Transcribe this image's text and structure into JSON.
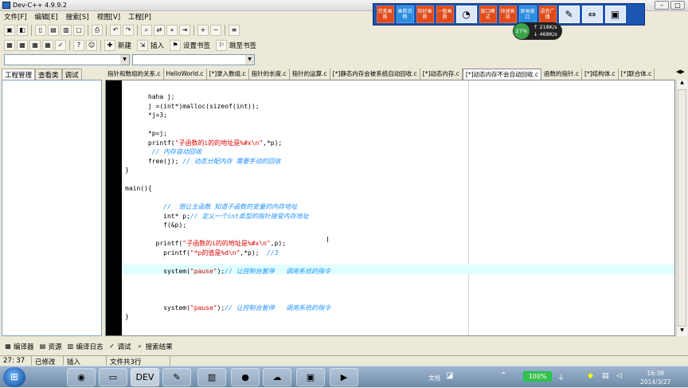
{
  "window": {
    "title": "Dev-C++ 4.9.9.2"
  },
  "menu": [
    "文件[F]",
    "编辑[E]",
    "搜索[S]",
    "视图[V]",
    "工程[P]"
  ],
  "toolbar": {
    "new": "新建",
    "insert": "插入",
    "set_bookmark": "设置书签",
    "goto_bookmark": "跳至书签"
  },
  "float_toolbar": {
    "buttons": [
      "完美画质",
      "画质流畅",
      "较好画质",
      "一般画质",
      "窗口模式",
      "快速高效",
      "原画窗口",
      "语音广播"
    ]
  },
  "speed": {
    "percent": "27%",
    "up": "218K/s",
    "down": "468K/s"
  },
  "left_tabs": [
    "工程管理",
    "查看类",
    "调试"
  ],
  "file_tabs": [
    "指针和数组的关系.c",
    "HelloWorld.c",
    "[*]录入数组.c",
    "指针的长度.c",
    "指针的运算.c",
    "[*]静态内存会被系统自动回收.c",
    "[*]动态内存.c",
    "[*]动态内存不会自动回收.c",
    "函数的指针.c",
    "[*]结构体.c",
    "[*]联合体.c"
  ],
  "code": [
    {
      "indent": "      ",
      "parts": [
        {
          "t": "haha j;",
          "c": ""
        }
      ]
    },
    {
      "indent": "      ",
      "parts": [
        {
          "t": "j =(int*)malloc(sizeof(int));",
          "c": ""
        }
      ]
    },
    {
      "indent": "      ",
      "parts": [
        {
          "t": "*j=3;",
          "c": ""
        }
      ]
    },
    {
      "indent": "",
      "parts": []
    },
    {
      "indent": "      ",
      "parts": [
        {
          "t": "*p=j;",
          "c": ""
        }
      ]
    },
    {
      "indent": "      ",
      "parts": [
        {
          "t": "printf(",
          "c": ""
        },
        {
          "t": "\"子函数的i的的地址是%#x\\n\"",
          "c": "str"
        },
        {
          "t": ",*p);",
          "c": ""
        }
      ]
    },
    {
      "indent": "       ",
      "parts": [
        {
          "t": "// 内存自动回收",
          "c": "cm"
        }
      ]
    },
    {
      "indent": "      ",
      "parts": [
        {
          "t": "free(j); ",
          "c": ""
        },
        {
          "t": "// 动态分配内存 需要手动的回收",
          "c": "cm"
        }
      ]
    },
    {
      "indent": "",
      "parts": [
        {
          "t": "}",
          "c": ""
        }
      ]
    },
    {
      "indent": "",
      "parts": []
    },
    {
      "indent": "",
      "parts": [
        {
          "t": "main(){",
          "c": ""
        }
      ]
    },
    {
      "indent": "",
      "parts": []
    },
    {
      "indent": "     ",
      "parts": [
        {
          "t": "     //  想让主函数 知道子函数的变量的内存地址",
          "c": "cm"
        }
      ]
    },
    {
      "indent": "          ",
      "parts": [
        {
          "t": "int* p;",
          "c": ""
        },
        {
          "t": "// 定义一个int类型的指针接受内存地址",
          "c": "cm"
        }
      ]
    },
    {
      "indent": "          ",
      "parts": [
        {
          "t": "f(&p);",
          "c": ""
        }
      ]
    },
    {
      "indent": "",
      "parts": []
    },
    {
      "indent": "        ",
      "parts": [
        {
          "t": "printf(",
          "c": ""
        },
        {
          "t": "\"子函数的i的的地址是%#x\\n\"",
          "c": "str"
        },
        {
          "t": ",p);",
          "c": ""
        }
      ]
    },
    {
      "indent": "          ",
      "parts": [
        {
          "t": "printf(",
          "c": ""
        },
        {
          "t": "\"*p的值是%d\\n\"",
          "c": "str"
        },
        {
          "t": ",*p);  ",
          "c": ""
        },
        {
          "t": "//3",
          "c": "cm"
        }
      ]
    },
    {
      "indent": "",
      "parts": []
    },
    {
      "indent": "          ",
      "parts": [
        {
          "t": "system(",
          "c": ""
        },
        {
          "t": "\"pause\"",
          "c": "str"
        },
        {
          "t": ");",
          "c": ""
        },
        {
          "t": "// 让控制台暂停   调用系统的指令",
          "c": "cm"
        }
      ]
    },
    {
      "indent": "",
      "parts": []
    },
    {
      "indent": "",
      "parts": []
    },
    {
      "indent": "",
      "parts": []
    },
    {
      "indent": "          ",
      "parts": [
        {
          "t": "system(",
          "c": ""
        },
        {
          "t": "\"pause\"",
          "c": "str"
        },
        {
          "t": ");",
          "c": ""
        },
        {
          "t": "// 让控制台暂停   调用系统的指令",
          "c": "cm"
        }
      ]
    },
    {
      "indent": "",
      "parts": [
        {
          "t": "}",
          "c": ""
        }
      ]
    }
  ],
  "bottom_tabs": [
    "编译器",
    "资源",
    "编译日志",
    "调试",
    "搜索结果"
  ],
  "status": {
    "position": "27: 37",
    "modified": "已修改",
    "mode": "插入",
    "lines": "文件共3行"
  },
  "tray": {
    "doc": "文档",
    "battery": "100%",
    "time": "16:38",
    "date": "2014/3/27"
  },
  "colors": {
    "string": "#e00000",
    "comment": "#1e90ff",
    "highlight_line": "#e0ffff",
    "gutter": "#000000"
  }
}
